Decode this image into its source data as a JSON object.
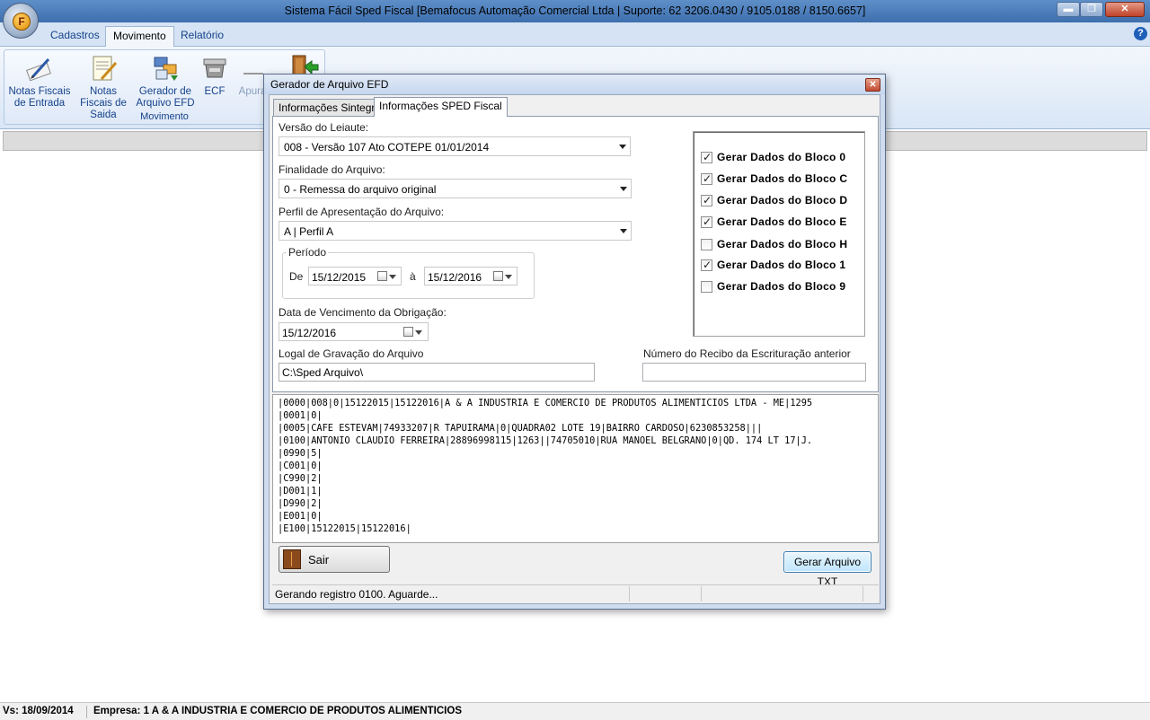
{
  "window": {
    "title": "Sistema Fácil Sped Fiscal [Bemafocus Automação Comercial Ltda | Suporte: 62 3206.0430 / 9105.0188 / 8150.6657]",
    "orb_letter": "F",
    "help_glyph": "?",
    "minimize_glyph": "▬",
    "maximize_glyph": "❐",
    "close_glyph": "✕"
  },
  "ribbon": {
    "tabs": [
      {
        "label": "Cadastros"
      },
      {
        "label": "Movimento"
      },
      {
        "label": "Relatório"
      }
    ],
    "active_tab": "Movimento",
    "buttons": [
      {
        "label": "Notas Fiscais de Entrada",
        "icon": "pen-paper-icon"
      },
      {
        "label": "Notas Fiscais de Saida",
        "icon": "notepad-pencil-icon"
      },
      {
        "label": "Gerador de Arquivo EFD",
        "icon": "file-generator-icon"
      },
      {
        "label": "ECF",
        "icon": "cash-register-icon"
      },
      {
        "label": "Apura",
        "icon": "calculator-icon"
      },
      {
        "label": "",
        "icon": "exit-door-icon"
      }
    ],
    "group_label": "Movimento"
  },
  "statusbar": {
    "version": "Vs: 18/09/2014",
    "empresa": "Empresa: 1 A & A INDUSTRIA E COMERCIO DE PRODUTOS ALIMENTICIOS"
  },
  "dialog": {
    "title": "Gerador de Arquivo EFD",
    "close_glyph": "✕",
    "tabs": [
      {
        "label": "Informações Sintegra"
      },
      {
        "label": "Informações SPED Fiscal"
      }
    ],
    "active_tab": "Informações SPED Fiscal",
    "versao": {
      "label": "Versão do Leiaute:",
      "value": "008 - Versão 107 Ato COTEPE 01/01/2014"
    },
    "finalidade": {
      "label": "Finalidade do Arquivo:",
      "value": "0 - Remessa do arquivo original"
    },
    "perfil": {
      "label": "Perfil de Apresentação do Arquivo:",
      "value": "A | Perfil A"
    },
    "periodo": {
      "label": "Período",
      "de_label": "De",
      "de_value": "15/12/2015",
      "ate_label": "à",
      "ate_value": "15/12/2016"
    },
    "vencimento": {
      "label": "Data de Vencimento da Obrigação:",
      "value": "15/12/2016"
    },
    "local": {
      "label": "Logal de Gravação do  Arquivo",
      "value": "C:\\Sped Arquivo\\"
    },
    "recibo": {
      "label": "Número do Recibo da Escrituração anterior",
      "value": ""
    },
    "blocos": [
      {
        "label": "Gerar Dados do Bloco 0",
        "checked": true
      },
      {
        "label": "Gerar Dados do Bloco C",
        "checked": true
      },
      {
        "label": "Gerar Dados do Bloco D",
        "checked": true
      },
      {
        "label": "Gerar Dados do Bloco E",
        "checked": true
      },
      {
        "label": "Gerar Dados do Bloco H",
        "checked": false
      },
      {
        "label": "Gerar Dados do Bloco 1",
        "checked": true
      },
      {
        "label": "Gerar Dados do Bloco 9",
        "checked": false
      }
    ],
    "log_lines": [
      "|0000|008|0|15122015|15122016|A & A INDUSTRIA E COMERCIO DE PRODUTOS ALIMENTICIOS LTDA - ME|1295",
      "|0001|0|",
      "|0005|CAFE ESTEVAM|74933207|R TAPUIRAMA|0|QUADRA02 LOTE 19|BAIRRO CARDOSO|6230853258|||",
      "|0100|ANTONIO CLAUDIO FERREIRA|28896998115|1263||74705010|RUA MANOEL BELGRANO|0|QD. 174 LT 17|J.",
      "|0990|5|",
      "|C001|0|",
      "|C990|2|",
      "|D001|1|",
      "|D990|2|",
      "|E001|0|",
      "|E100|15122015|15122016|"
    ],
    "sair_label": "Sair",
    "gerar_label": "Gerar Arquivo TXT",
    "status_text": "Gerando registro 0100. Aguarde..."
  }
}
